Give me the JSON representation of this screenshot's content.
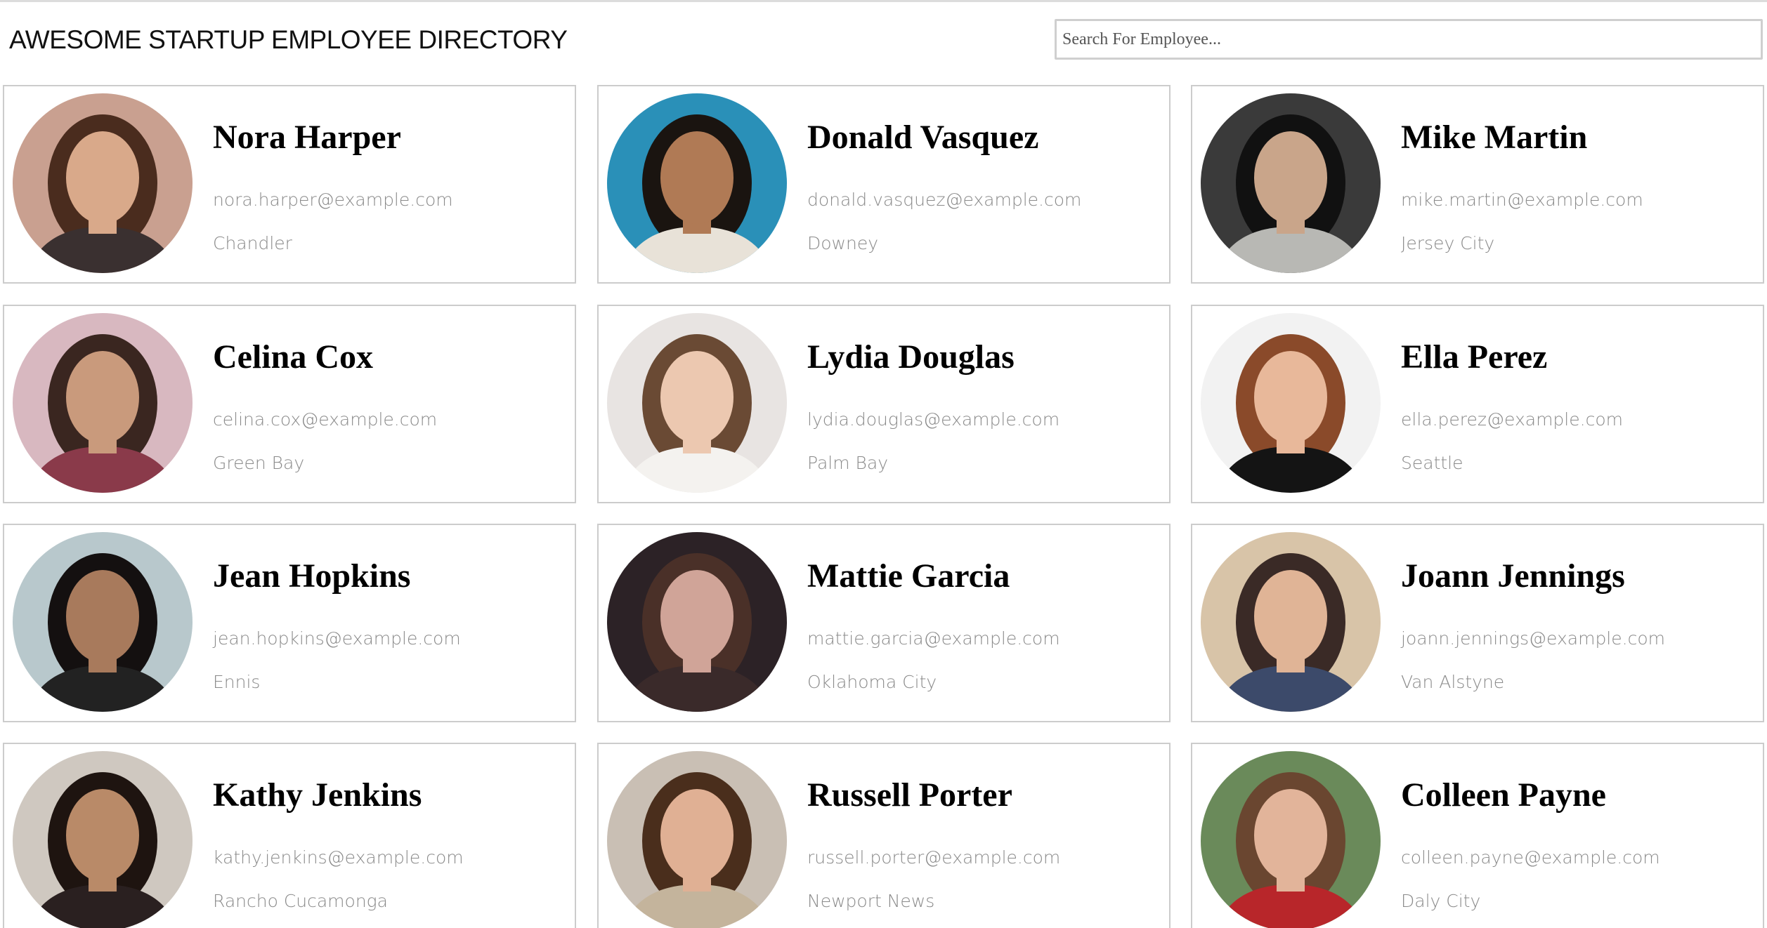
{
  "header": {
    "title": "AWESOME STARTUP EMPLOYEE DIRECTORY",
    "search_placeholder": "Search For Employee...",
    "search_value": ""
  },
  "employees": [
    {
      "name": "Nora Harper",
      "email": "nora.harper@example.com",
      "city": "Chandler",
      "avatar": {
        "bg": "#c9a090",
        "skin": "#d9a98a",
        "hair": "#4a2c1e",
        "shirt": "#3a3030"
      }
    },
    {
      "name": "Donald Vasquez",
      "email": "donald.vasquez@example.com",
      "city": "Downey",
      "avatar": {
        "bg": "#2a90b8",
        "skin": "#b07a55",
        "hair": "#1a1410",
        "shirt": "#e8e2d8"
      }
    },
    {
      "name": "Mike Martin",
      "email": "mike.martin@example.com",
      "city": "Jersey City",
      "avatar": {
        "bg": "#3a3a3a",
        "skin": "#c9a58a",
        "hair": "#111111",
        "shirt": "#b8b8b4"
      }
    },
    {
      "name": "Celina Cox",
      "email": "celina.cox@example.com",
      "city": "Green Bay",
      "avatar": {
        "bg": "#d8b8c0",
        "skin": "#c99a7c",
        "hair": "#3a2620",
        "shirt": "#8a3a4a"
      }
    },
    {
      "name": "Lydia Douglas",
      "email": "lydia.douglas@example.com",
      "city": "Palm Bay",
      "avatar": {
        "bg": "#e8e4e2",
        "skin": "#ecc8b0",
        "hair": "#6a4a34",
        "shirt": "#f4f2ef"
      }
    },
    {
      "name": "Ella Perez",
      "email": "ella.perez@example.com",
      "city": "Seattle",
      "avatar": {
        "bg": "#f2f2f2",
        "skin": "#e8b89a",
        "hair": "#8a4a2a",
        "shirt": "#141414"
      }
    },
    {
      "name": "Jean Hopkins",
      "email": "jean.hopkins@example.com",
      "city": "Ennis",
      "avatar": {
        "bg": "#b8c8cc",
        "skin": "#a87a5c",
        "hair": "#141010",
        "shirt": "#222222"
      }
    },
    {
      "name": "Mattie Garcia",
      "email": "mattie.garcia@example.com",
      "city": "Oklahoma City",
      "avatar": {
        "bg": "#2c2226",
        "skin": "#d0a498",
        "hair": "#4a3028",
        "shirt": "#3a2a2a"
      }
    },
    {
      "name": "Joann Jennings",
      "email": "joann.jennings@example.com",
      "city": "Van Alstyne",
      "avatar": {
        "bg": "#d8c4a8",
        "skin": "#e0b496",
        "hair": "#3a2a26",
        "shirt": "#3c4a6a"
      }
    },
    {
      "name": "Kathy Jenkins",
      "email": "kathy.jenkins@example.com",
      "city": "Rancho Cucamonga",
      "avatar": {
        "bg": "#cfc8c0",
        "skin": "#b98a68",
        "hair": "#1e1410",
        "shirt": "#2a2020"
      }
    },
    {
      "name": "Russell Porter",
      "email": "russell.porter@example.com",
      "city": "Newport News",
      "avatar": {
        "bg": "#c9bfb4",
        "skin": "#e0b094",
        "hair": "#4a2e1c",
        "shirt": "#c4b49c"
      }
    },
    {
      "name": "Colleen Payne",
      "email": "colleen.payne@example.com",
      "city": "Daly City",
      "avatar": {
        "bg": "#6a8a5a",
        "skin": "#e2b49a",
        "hair": "#6a4630",
        "shirt": "#b8262a"
      }
    }
  ]
}
